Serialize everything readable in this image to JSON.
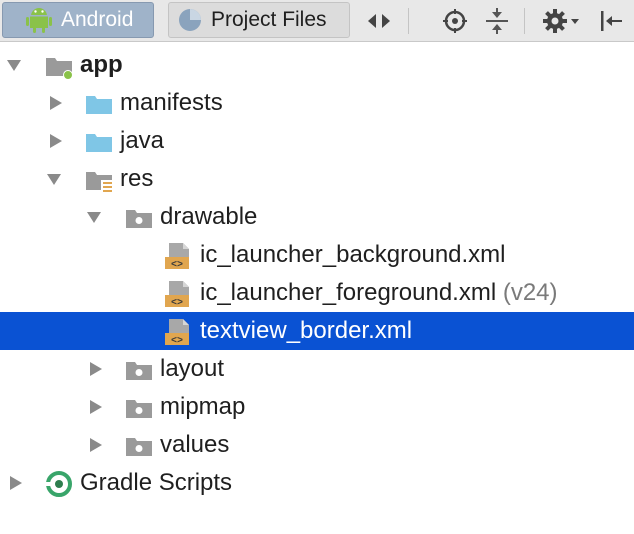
{
  "toolbar": {
    "android_tab_label": "Android",
    "project_files_tab_label": "Project Files"
  },
  "tree": {
    "app": "app",
    "manifests": "manifests",
    "java": "java",
    "res": "res",
    "drawable": "drawable",
    "file1": "ic_launcher_background.xml",
    "file2": "ic_launcher_foreground.xml",
    "file2_suffix": "(v24)",
    "file3": "textview_border.xml",
    "layout": "layout",
    "mipmap": "mipmap",
    "values": "values",
    "gradle": "Gradle Scripts"
  },
  "colors": {
    "selection": "#0a52d3",
    "folder_blue": "#7fc6e6",
    "folder_gray": "#9a9a9a",
    "android_green": "#8ac249",
    "xml_orange": "#e1a64f"
  }
}
